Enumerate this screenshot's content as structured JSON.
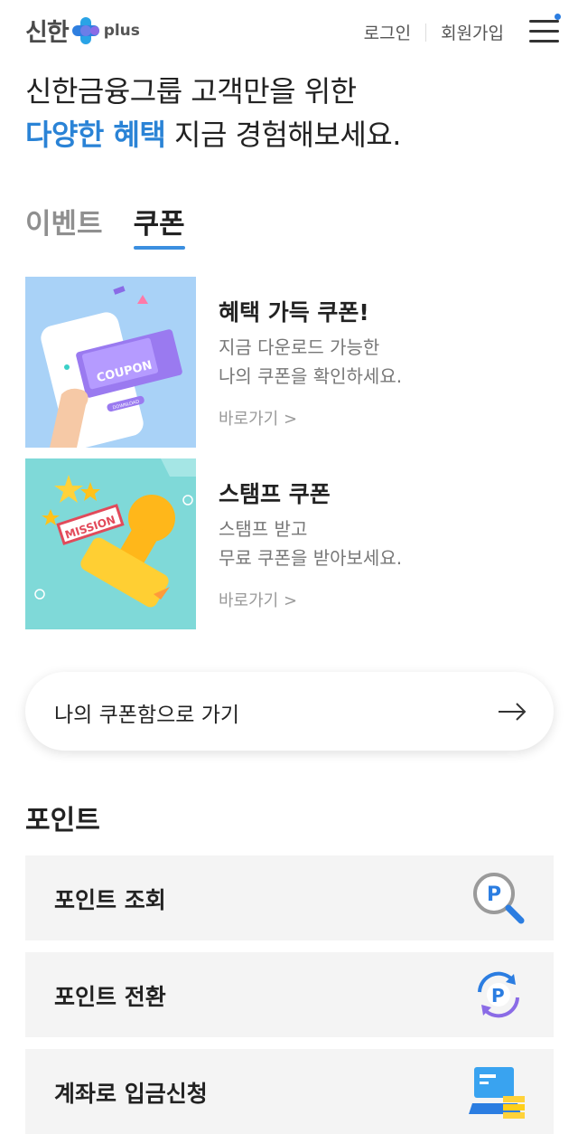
{
  "header": {
    "logo_text": "신한",
    "logo_suffix": "plus",
    "login": "로그인",
    "signup": "회원가입",
    "colors": {
      "brand_blue": "#2b7de1",
      "accent_purple": "#8a6be6"
    }
  },
  "hero": {
    "line1": "신한금융그룹 고객만을 위한",
    "line2_accent": "다양한 혜택",
    "line2_rest": " 지금 경험해보세요."
  },
  "tabs": [
    {
      "label": "이벤트",
      "active": false
    },
    {
      "label": "쿠폰",
      "active": true
    }
  ],
  "cards": [
    {
      "title": "혜택 가득 쿠폰!",
      "desc1": "지금 다운로드 가능한",
      "desc2": "나의 쿠폰을 확인하세요.",
      "link": "바로가기 >",
      "image_text": "COUPON",
      "image_small": "DOWNLOAD"
    },
    {
      "title": "스탬프 쿠폰",
      "desc1": "스탬프 받고",
      "desc2": "무료 쿠폰을 받아보세요.",
      "link": "바로가기 >",
      "image_text": "MISSION"
    }
  ],
  "coupon_box": {
    "label": "나의 쿠폰함으로 가기",
    "icon": "arrow-right-icon"
  },
  "points": {
    "title": "포인트",
    "items": [
      {
        "label": "포인트 조회",
        "icon": "point-search-icon"
      },
      {
        "label": "포인트 전환",
        "icon": "point-exchange-icon"
      },
      {
        "label": "계좌로 입금신청",
        "icon": "account-deposit-icon"
      }
    ]
  }
}
